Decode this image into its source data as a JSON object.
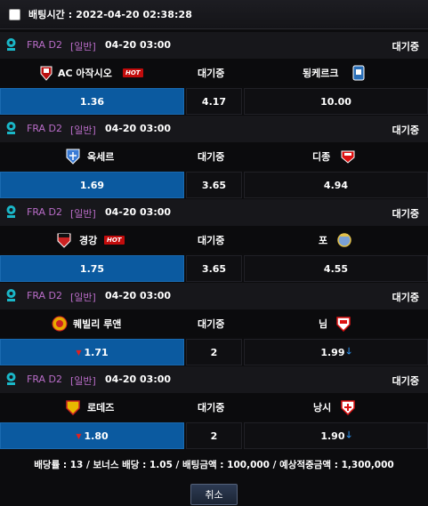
{
  "bet_time": "배팅시간 : 2022-04-20 02:38:28",
  "hot_label": "HOT",
  "matches": [
    {
      "league": "FRA D2",
      "type": "[일반]",
      "time": "04-20 03:00",
      "status": "대기중",
      "home": "AC 아작시오",
      "away": "됭케르크",
      "mid": "대기중",
      "home_odd": "1.36",
      "draw_odd": "4.17",
      "away_odd": "10.00",
      "home_hot": true,
      "selected": "home",
      "home_color": "#b11",
      "away_color": "#2a6fb8"
    },
    {
      "league": "FRA D2",
      "type": "[일반]",
      "time": "04-20 03:00",
      "status": "대기중",
      "home": "옥세르",
      "away": "디종",
      "mid": "대기중",
      "home_odd": "1.69",
      "draw_odd": "3.65",
      "away_odd": "4.94",
      "home_hot": false,
      "selected": "home",
      "home_color": "#3a7bd5",
      "away_color": "#d11"
    },
    {
      "league": "FRA D2",
      "type": "[일반]",
      "time": "04-20 03:00",
      "status": "대기중",
      "home": "경강",
      "away": "포",
      "mid": "대기중",
      "home_odd": "1.75",
      "draw_odd": "3.65",
      "away_odd": "4.55",
      "home_hot": true,
      "selected": "home",
      "home_color": "#c22",
      "away_color": "#7aa0d6"
    },
    {
      "league": "FRA D2",
      "type": "[일반]",
      "time": "04-20 03:00",
      "status": "대기중",
      "home": "퀘빌리 루앤",
      "away": "님",
      "mid": "대기중",
      "home_odd": "1.71",
      "draw_odd": "2",
      "away_odd": "1.99",
      "home_hot": false,
      "selected": "home",
      "home_color": "#e7a900",
      "away_color": "#d11"
    },
    {
      "league": "FRA D2",
      "type": "[일반]",
      "time": "04-20 03:00",
      "status": "대기중",
      "home": "로데즈",
      "away": "낭시",
      "mid": "대기중",
      "home_odd": "1.80",
      "draw_odd": "2",
      "away_odd": "1.90",
      "home_hot": false,
      "selected": "home",
      "home_color": "#e8b800",
      "away_color": "#d11"
    }
  ],
  "summary": "배당률 : 13 / 보너스 배당 : 1.05 / 배팅금액 : 100,000 / 예상적중금액 : 1,300,000",
  "cancel_label": "취소",
  "colors": {
    "selected": "#0b5aa0",
    "league": "#b86cc7",
    "hot": "#c20c0c"
  }
}
